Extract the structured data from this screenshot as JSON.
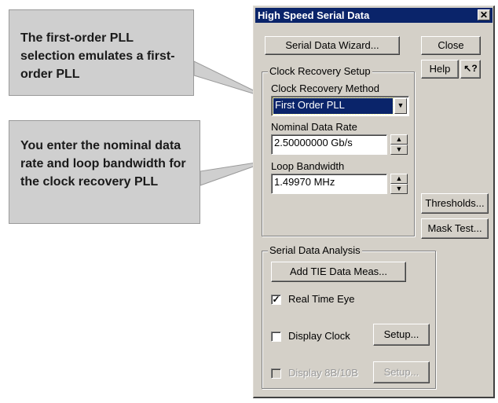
{
  "callouts": [
    {
      "text": "The first-order PLL selection emulates a first-order PLL"
    },
    {
      "text": "You enter the nominal data rate and loop bandwidth for the clock recovery PLL"
    }
  ],
  "dialog": {
    "title": "High Speed Serial Data",
    "close_glyph": "✕",
    "buttons": {
      "wizard": "Serial Data Wizard...",
      "close": "Close",
      "help": "Help",
      "whats_this_glyph": "↖?",
      "thresholds": "Thresholds...",
      "mask_test": "Mask Test..."
    },
    "clock_recovery": {
      "group_label": "Clock Recovery Setup",
      "method_label": "Clock Recovery Method",
      "method_value": "First Order PLL",
      "rate_label": "Nominal Data Rate",
      "rate_value": "2.50000000 Gb/s",
      "bandwidth_label": "Loop Bandwidth",
      "bandwidth_value": "1.49970 MHz"
    },
    "analysis": {
      "group_label": "Serial Data Analysis",
      "add_tie_button": "Add TIE Data Meas...",
      "real_time_eye": {
        "label": "Real Time Eye",
        "checked": true
      },
      "display_clock": {
        "label": "Display Clock",
        "checked": false,
        "setup": "Setup..."
      },
      "display_8b10b": {
        "label": "Display 8B/10B",
        "checked": false,
        "setup": "Setup...",
        "enabled": false
      }
    }
  },
  "colors": {
    "titlebar": "#0a246a",
    "dialog_face": "#d4d0c8",
    "callout_fill": "#cfcfcf",
    "selection": "#0a246a"
  }
}
